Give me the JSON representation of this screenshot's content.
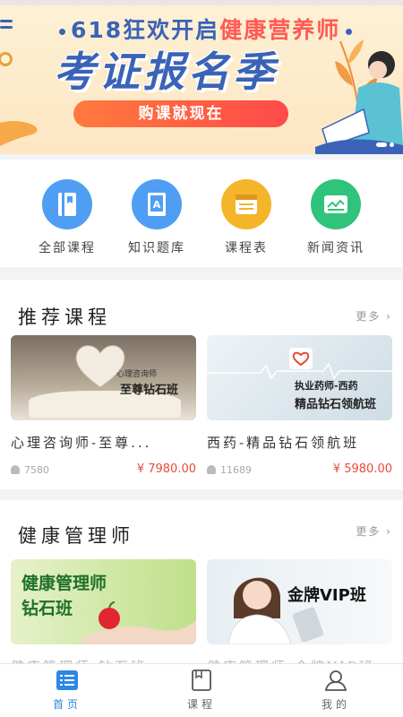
{
  "banner": {
    "headline_prefix": "618狂欢开启",
    "headline_highlight": "健康营养师",
    "big_title": "考证报名季",
    "cta_label": "购课就现在"
  },
  "quick_nav": [
    {
      "label": "全部课程",
      "icon": "book-icon",
      "color": "#4f9ef3"
    },
    {
      "label": "知识题库",
      "icon": "question-bank-icon",
      "color": "#4f9ef3"
    },
    {
      "label": "课程表",
      "icon": "schedule-icon",
      "color": "#f4b52a"
    },
    {
      "label": "新闻资讯",
      "icon": "news-icon",
      "color": "#2fc37c"
    }
  ],
  "recommended": {
    "title": "推荐课程",
    "more": "更多",
    "courses": [
      {
        "thumb_line1": "心理咨询师",
        "thumb_line2": "至尊钻石班",
        "title": "心理咨询师-至尊...",
        "learners": "7580",
        "price": "¥ 7980.00"
      },
      {
        "thumb_line1": "执业药师-西药",
        "thumb_line2": "精品钻石领航班",
        "title": "西药-精品钻石领航班",
        "learners": "11689",
        "price": "¥ 5980.00"
      }
    ]
  },
  "health_manager": {
    "title": "健康管理师",
    "more": "更多",
    "courses": [
      {
        "thumb_line1": "健康管理师",
        "thumb_line2": "钻石班",
        "title": "健康管理师-钻石班"
      },
      {
        "thumb_line1": "金牌VIP班",
        "thumb_line2": "",
        "title": "健康管理师-金牌VIP班"
      }
    ]
  },
  "tabbar": [
    {
      "label": "首页",
      "icon": "home-list-icon",
      "active": true
    },
    {
      "label": "课程",
      "icon": "course-book-icon",
      "active": false
    },
    {
      "label": "我的",
      "icon": "user-icon",
      "active": false
    }
  ],
  "colors": {
    "accent": "#2e86e6",
    "price": "#e84a3c",
    "banner_blue": "#3a63b8",
    "banner_red": "#ff5a55"
  }
}
